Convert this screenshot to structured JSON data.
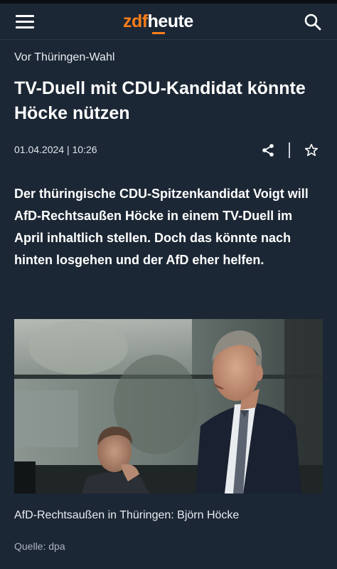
{
  "header": {
    "logo_part1": "zdf",
    "logo_part2": "heute",
    "menu_icon": "hamburger-menu-icon",
    "search_icon": "search-icon"
  },
  "article": {
    "kicker": "Vor Thüringen-Wahl",
    "title": "TV-Duell mit CDU-Kandidat könnte Höcke nützen",
    "date": "01.04.2024 | 10:26",
    "share_icon": "share-icon",
    "bookmark_icon": "star-icon",
    "lead": "Der thüringische CDU-Spitzenkandidat Voigt will AfD-Rechtsaußen Höcke in einem TV-Duell im April inhaltlich stellen. Doch das könnte nach hinten losgehen und der AfD eher helfen.",
    "image_caption": "AfD-Rechtsaußen in Thüringen: Björn Höcke",
    "image_source": "Quelle: dpa"
  },
  "colors": {
    "background": "#1c2735",
    "brand_orange": "#fa7d19",
    "text": "#ffffff"
  }
}
